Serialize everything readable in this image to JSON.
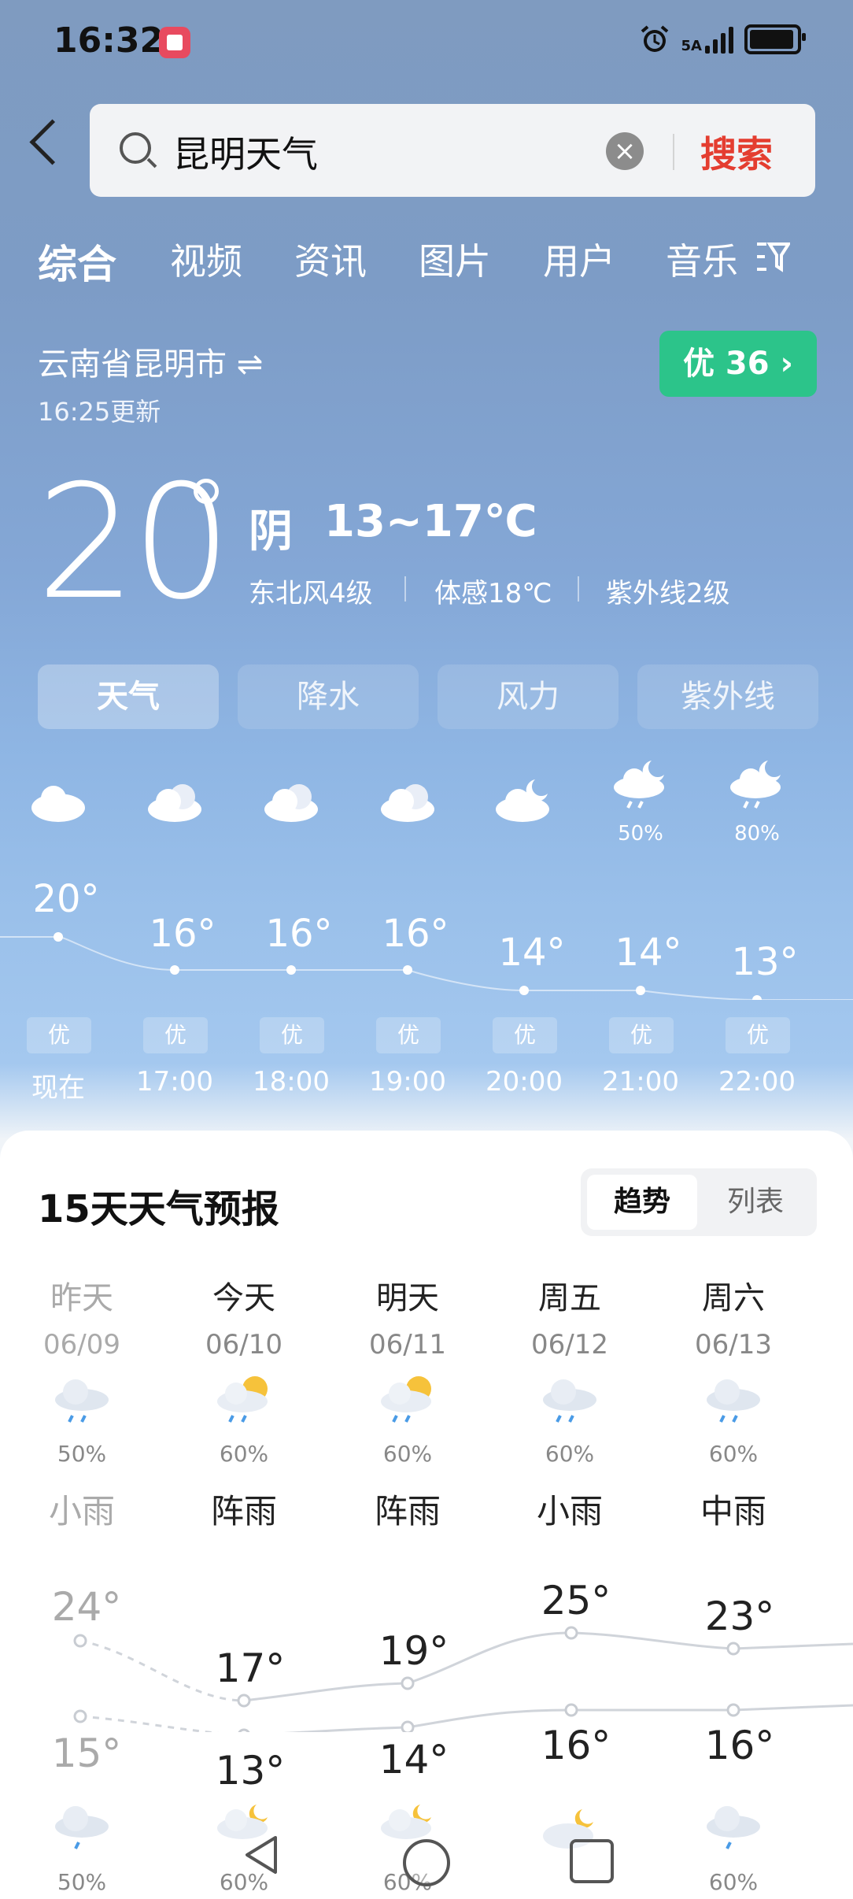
{
  "status_bar": {
    "time": "16:32",
    "network": "5A",
    "battery_icon": "battery-icon"
  },
  "search": {
    "query": "昆明天气",
    "button": "搜索"
  },
  "tabs": [
    "综合",
    "视频",
    "资讯",
    "图片",
    "用户",
    "音乐"
  ],
  "location": {
    "name": "云南省昆明市",
    "swap": "⇌",
    "updated": "16:25更新"
  },
  "aqi": {
    "label": "优 36 ›"
  },
  "current": {
    "temp": "20",
    "condition": "阴",
    "range": "13~17℃",
    "wind": "东北风4级",
    "feels": "体感18℃",
    "uv": "紫外线2级"
  },
  "segments": [
    "天气",
    "降水",
    "风力",
    "紫外线"
  ],
  "hourly": [
    {
      "time": "现在",
      "temp": "20°",
      "pop": "",
      "aq": "优",
      "icon": "cloud-icon"
    },
    {
      "time": "17:00",
      "temp": "16°",
      "pop": "",
      "aq": "优",
      "icon": "cloud-icon"
    },
    {
      "time": "18:00",
      "temp": "16°",
      "pop": "",
      "aq": "优",
      "icon": "cloud-icon"
    },
    {
      "time": "19:00",
      "temp": "16°",
      "pop": "",
      "aq": "优",
      "icon": "cloud-icon"
    },
    {
      "time": "20:00",
      "temp": "14°",
      "pop": "",
      "aq": "优",
      "icon": "cloud-moon-icon"
    },
    {
      "time": "21:00",
      "temp": "14°",
      "pop": "50%",
      "aq": "优",
      "icon": "rain-moon-icon"
    },
    {
      "time": "22:00",
      "temp": "13°",
      "pop": "80%",
      "aq": "优",
      "icon": "rain-moon-icon"
    }
  ],
  "forecast": {
    "title": "15天天气预报",
    "toggle": {
      "active": "趋势",
      "inactive": "列表"
    },
    "days": [
      {
        "name": "昨天",
        "date": "06/09",
        "pop": "50%",
        "cond": "小雨",
        "high": "24°",
        "low": "15°",
        "night_pop": "50%",
        "icon": "rain-cloud-icon"
      },
      {
        "name": "今天",
        "date": "06/10",
        "pop": "60%",
        "cond": "阵雨",
        "high": "17°",
        "low": "13°",
        "night_pop": "60%",
        "icon": "sun-rain-icon"
      },
      {
        "name": "明天",
        "date": "06/11",
        "pop": "60%",
        "cond": "阵雨",
        "high": "19°",
        "low": "14°",
        "night_pop": "60%",
        "icon": "sun-rain-icon"
      },
      {
        "name": "周五",
        "date": "06/12",
        "pop": "60%",
        "cond": "小雨",
        "high": "25°",
        "low": "16°",
        "night_pop": "",
        "icon": "rain-cloud-icon"
      },
      {
        "name": "周六",
        "date": "06/13",
        "pop": "60%",
        "cond": "中雨",
        "high": "23°",
        "low": "16°",
        "night_pop": "60%",
        "icon": "rain-cloud-icon"
      }
    ]
  },
  "colors": {
    "accent_red": "#e43d30",
    "aqi_green": "#2cc48a"
  }
}
